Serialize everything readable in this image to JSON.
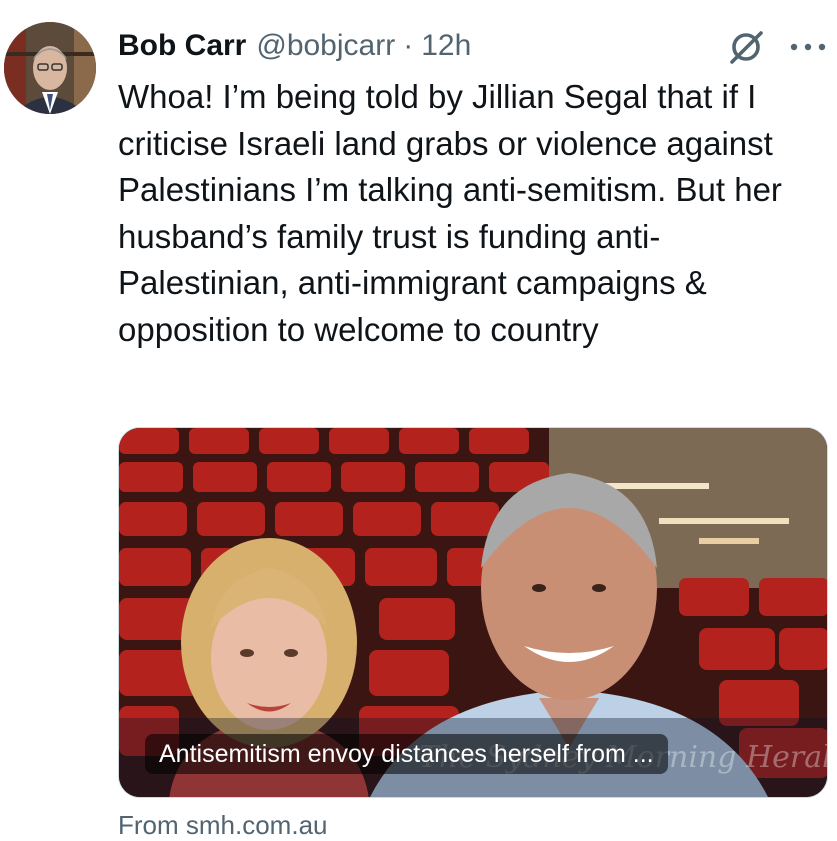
{
  "author": {
    "name": "Bob Carr",
    "handle": "@bobjcarr",
    "separator": "·",
    "time": "12h"
  },
  "actions": {
    "grok_icon": "grok-icon",
    "more_icon": "more-horizontal-icon"
  },
  "tweet": {
    "text": "Whoa! I’m being told by Jillian Segal that if I criticise Israeli land grabs or violence against Palestinians I’m talking anti-semitism. But her husband’s family trust is funding anti-Palestinian, anti-immigrant campaigns & opposition to welcome to country"
  },
  "card": {
    "title": "Antisemitism envoy distances herself from ...",
    "masthead": "The Sydney Morning Herald",
    "source": "From smh.com.au"
  },
  "colors": {
    "text_primary": "#0f1419",
    "text_secondary": "#536471",
    "theatre_seat_red": "#b3221c"
  }
}
